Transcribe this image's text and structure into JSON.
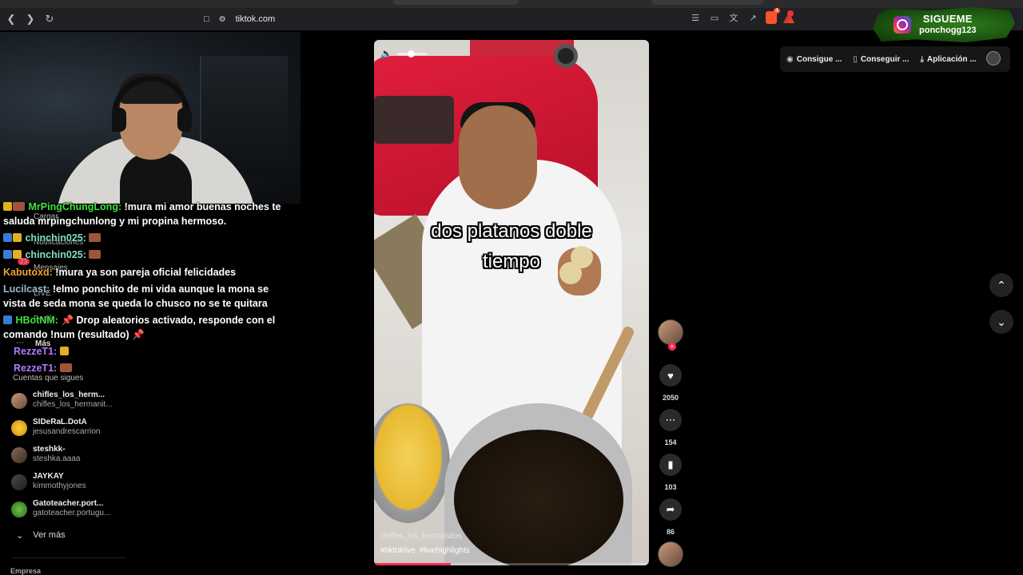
{
  "browser": {
    "url": "tiktok.com",
    "back_icon": "chevron-left-icon",
    "forward_icon": "chevron-right-icon",
    "reload_icon": "reload-icon",
    "brave_count": "4"
  },
  "overlay": {
    "title": "SIGUEME",
    "username": "ponchogg123"
  },
  "sidebar_ghost": {
    "items": [
      "Cargar",
      "Notificaciones",
      "Mensajes",
      "LIVE",
      "Perfil",
      "Más"
    ],
    "messages_badge": "23"
  },
  "chat": [
    {
      "user": "MrPingChungLong:",
      "text": "!mura mi amor buenas noches te saluda mrpingchunlong y mi propina hermoso."
    },
    {
      "user": "chinchin025:",
      "text": ""
    },
    {
      "user": "chinchin025:",
      "text": ""
    },
    {
      "user": "Kabutoxd:",
      "text": "!mura ya son pareja oficial felicidades"
    },
    {
      "user": "Lucilcast:",
      "text": "!elmo ponchito de mi vida aunque la mona se vista de seda mona se queda lo chusco no se te quitara"
    },
    {
      "user": "HBotNM:",
      "text": "Drop aleatorios activado, responde con el comando !num (resultado)"
    },
    {
      "user": "RezzeT1:",
      "text": ""
    },
    {
      "user": "RezzeT1:",
      "text": ""
    }
  ],
  "following": {
    "title": "Cuentas que sigues",
    "accounts": [
      {
        "name": "chifles_los_herm...",
        "handle": "chifles_los_hermanit..."
      },
      {
        "name": "SIDeRaL.DotA",
        "handle": "jesusandrescarrion"
      },
      {
        "name": "steshkk-",
        "handle": "steshka.aaaa"
      },
      {
        "name": "JAYKAY",
        "handle": "kimmothyjones"
      },
      {
        "name": "Gatoteacher.port...",
        "handle": "gatoteacher.portugu..."
      }
    ],
    "see_more": "Ver más",
    "footer": "Empresa"
  },
  "video": {
    "caption_line1": "dos platanos doble",
    "caption_line2": "tiempo",
    "author": "chifles_los_hermanitos",
    "tags": [
      "#tiktoklive",
      "#livehighlights"
    ],
    "progress_percent": 28,
    "volume_percent": 45
  },
  "actions": {
    "likes": "2050",
    "comments": "154",
    "saves": "103",
    "shares": "86"
  },
  "top_links": {
    "items": [
      "Consigue ...",
      "Conseguir ...",
      "Aplicación ..."
    ]
  },
  "colors": {
    "tiktok_red": "#fe2c55",
    "chat_green": "#3fe23f"
  }
}
